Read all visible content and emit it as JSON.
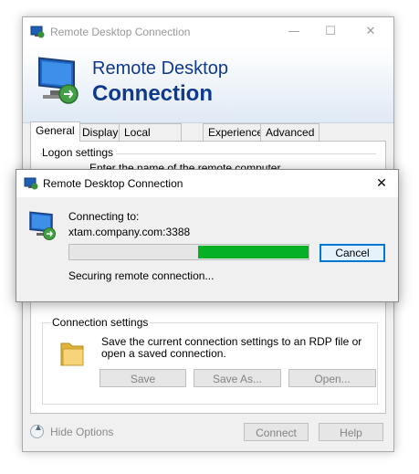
{
  "main_window": {
    "title": "Remote Desktop Connection",
    "controls": {
      "minimize": "—",
      "maximize": "☐",
      "close": "✕"
    },
    "banner": {
      "line1": "Remote Desktop",
      "line2": "Connection"
    },
    "tabs": [
      {
        "label": "General",
        "active": true
      },
      {
        "label": "Display"
      },
      {
        "label": "Local Resources"
      },
      {
        "label": "Experience"
      },
      {
        "label": "Advanced"
      }
    ],
    "logon_settings": {
      "label": "Logon settings",
      "peek_text": "Enter the name of the remote computer."
    },
    "connection_settings": {
      "label": "Connection settings",
      "description": "Save the current connection settings to an RDP file or open a saved connection.",
      "save": "Save",
      "save_as": "Save As...",
      "open": "Open..."
    },
    "hide_options": "Hide Options",
    "connect": "Connect",
    "help": "Help"
  },
  "dialog": {
    "title": "Remote Desktop Connection",
    "close": "✕",
    "connecting_label": "Connecting to:",
    "host": "xtam.company.com:3388",
    "progress_start": 0.54,
    "progress_end": 1.0,
    "progress_color": "#06b025",
    "cancel": "Cancel",
    "status": "Securing remote connection..."
  },
  "colors": {
    "banner_text": "#0f3a8c",
    "focus_border": "#0078d7"
  },
  "icons": [
    "rdp-app-icon",
    "rdp-monitor-icon",
    "folder-icon",
    "chevron-up-icon"
  ]
}
